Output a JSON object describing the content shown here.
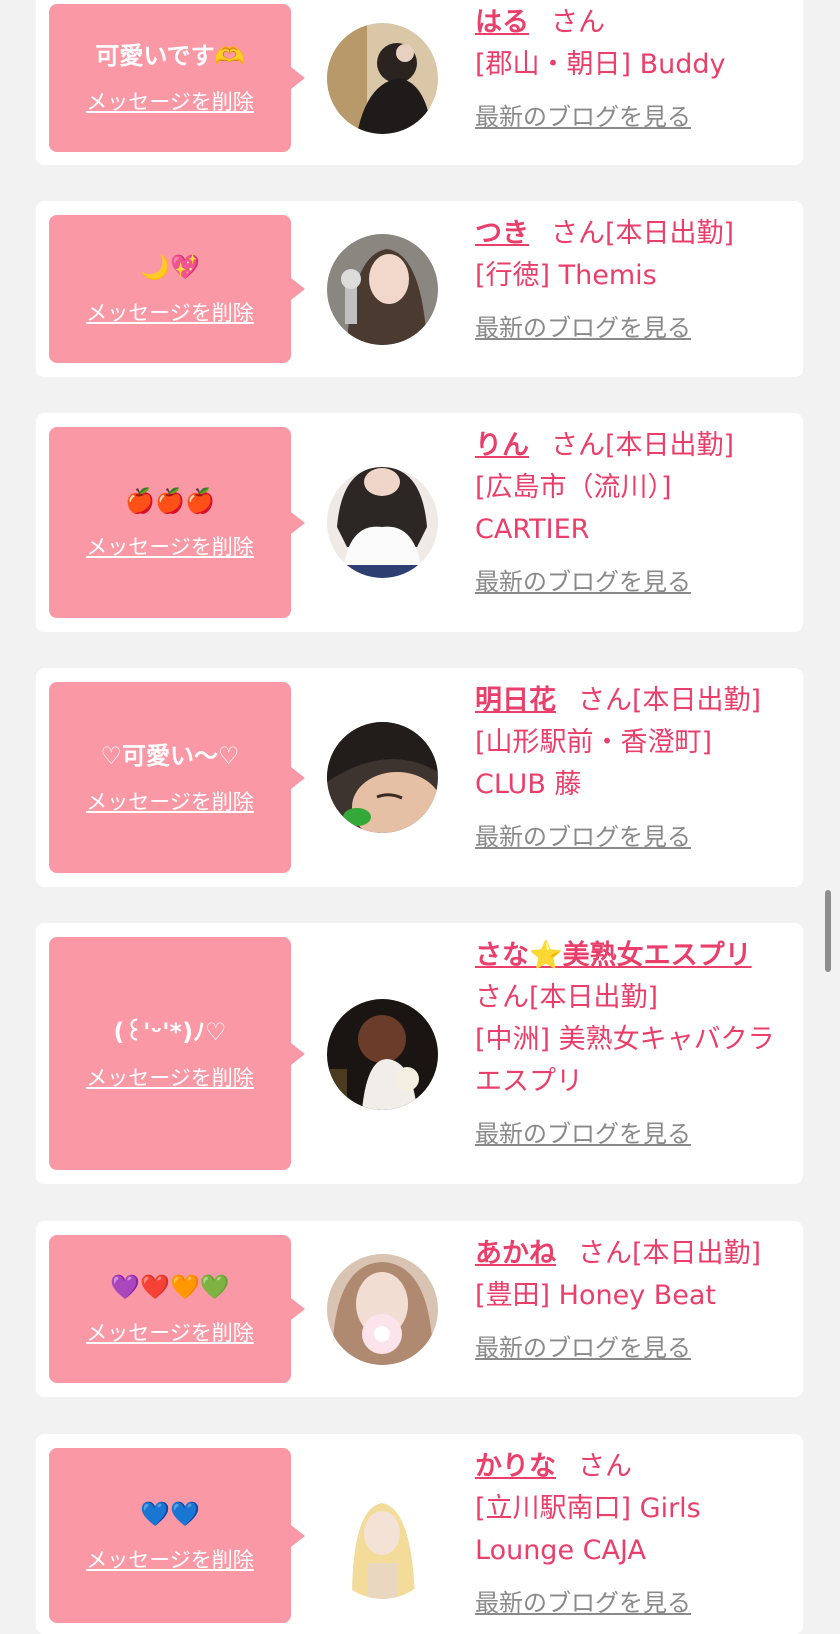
{
  "labels": {
    "delete": "メッセージを削除",
    "blog": "最新のブログを見る",
    "san": "さん"
  },
  "colors": {
    "background": "#f2f2f2",
    "bubble": "#fb98a5",
    "accent": "#ea3f6b",
    "link_gray": "#8a8a8a"
  },
  "cards": [
    {
      "message": "可愛いです🫶",
      "name": "はる",
      "status": "",
      "shop": "[郡山・朝日] Buddy"
    },
    {
      "message": "🌙💖",
      "name": "つき",
      "status": "[本日出勤]",
      "shop": "[行徳] Themis"
    },
    {
      "message": "🍎🍎🍎",
      "name": "りん",
      "status": "[本日出勤]",
      "shop": "[広島市（流川）] CARTIER"
    },
    {
      "message": "♡可愛い〜♡",
      "name": "明日花",
      "status": "[本日出勤]",
      "shop": "[山形駅前・香澄町] CLUB 藤"
    },
    {
      "message": "(꒰'ᵕ'*)ﾉ♡",
      "name": "さな⭐美熟女エスプリ",
      "status": "[本日出勤]",
      "shop": "[中洲] 美熟女キャバクラ エスプリ"
    },
    {
      "message": "💜❤️🧡💚",
      "name": "あかね",
      "status": "[本日出勤]",
      "shop": "[豊田] Honey Beat"
    },
    {
      "message": "💙💙",
      "name": "かりな",
      "status": "",
      "shop": "[立川駅南口] Girls Lounge CAJA"
    }
  ]
}
